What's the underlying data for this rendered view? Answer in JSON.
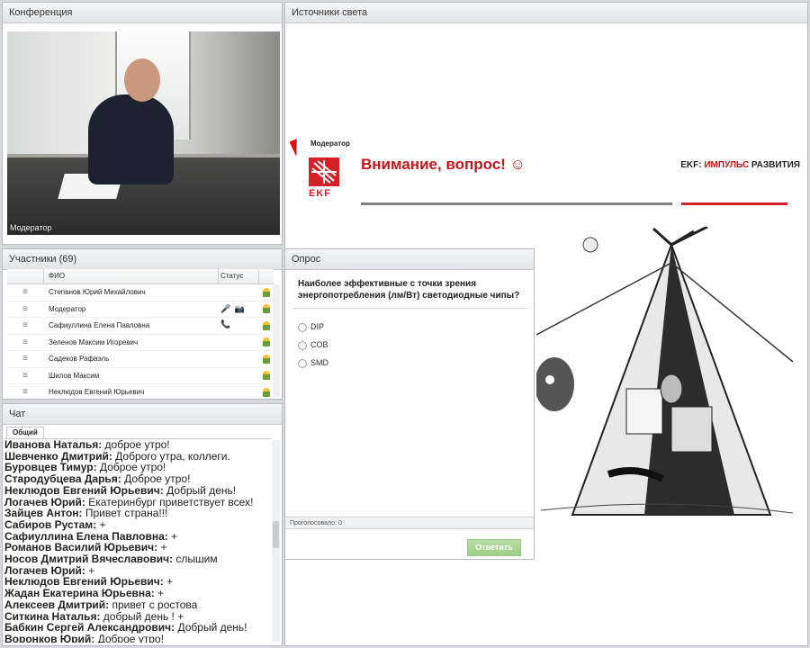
{
  "conference": {
    "title": "Конференция",
    "video_label": "Модератор"
  },
  "participants": {
    "title": "Участники (69)",
    "columns": {
      "name": "ФИО",
      "status": "Статус"
    },
    "rows": [
      {
        "name": "Степанов Юрий Михайлович",
        "status": ""
      },
      {
        "name": "Модератор",
        "status": "🎤 📷 📞"
      },
      {
        "name": "Сафиуллина Елена Павловна",
        "status": ""
      },
      {
        "name": "Зеленов  Максим Игоревич",
        "status": ""
      },
      {
        "name": "Садеков Рафаэль",
        "status": ""
      },
      {
        "name": "Шилов  Максим",
        "status": ""
      },
      {
        "name": "Неклюдов Евгений Юрьевич",
        "status": ""
      }
    ]
  },
  "chat": {
    "title": "Чат",
    "tab": "Общий",
    "messages": [
      {
        "author": "Иванова Наталья:",
        "text": " доброе утро!"
      },
      {
        "author": "Шевченко Дмитрий:",
        "text": " Доброго утра, коллеги."
      },
      {
        "author": "Буровцев Тимур:",
        "text": " Доброе утро!"
      },
      {
        "author": "Стародубцева Дарья:",
        "text": " Доброе утро!"
      },
      {
        "author": "Неклюдов Евгений Юрьевич:",
        "text": " Добрый день!"
      },
      {
        "author": "Логачев Юрий:",
        "text": " Екатеринбург приветствует всех!"
      },
      {
        "author": "Зайцев Антон:",
        "text": " Привет страна!!!"
      },
      {
        "author": "Сабиров Рустам:",
        "text": " +"
      },
      {
        "author": "Сафиуллина Елена Павловна:",
        "text": " +"
      },
      {
        "author": "Романов  Василий Юрьевич:",
        "text": " +"
      },
      {
        "author": "Носов Дмитрий Вячеславович:",
        "text": " слышим"
      },
      {
        "author": "Логачев Юрий:",
        "text": " +"
      },
      {
        "author": "Неклюдов Евгений Юрьевич:",
        "text": " +"
      },
      {
        "author": "Жадан Екатерина Юрьевна:",
        "text": " +"
      },
      {
        "author": "Алексеев Дмитрий:",
        "text": " привет с ростова"
      },
      {
        "author": "Ситкина Наталья:",
        "text": " добрый день ! +"
      },
      {
        "author": "Бабкин Сергей  Александрович:",
        "text": " Добрый день!"
      },
      {
        "author": "Воронков Юрий:",
        "text": " Доброе утро!"
      }
    ]
  },
  "sources": {
    "title": "Источники света",
    "moderator_label": "Модератор",
    "slide_title": "Внимание, вопрос! ☺",
    "brand_prefix": "EKF: ",
    "brand_highlight": "ИМПУЛЬС",
    "brand_suffix": " РАЗВИТИЯ",
    "logo_text": "EKF"
  },
  "poll": {
    "title": "Опрос",
    "question": "Наиболее эффективные с точки зрения энергопотребления (лм/Вт) светодиодные чипы?",
    "options": [
      "DIP",
      "COB",
      "SMD"
    ],
    "voted": "Проголосовало: 0",
    "submit": "Ответить"
  },
  "colors": {
    "accent_red": "#d62027",
    "submit_green": "#a6d38f"
  }
}
